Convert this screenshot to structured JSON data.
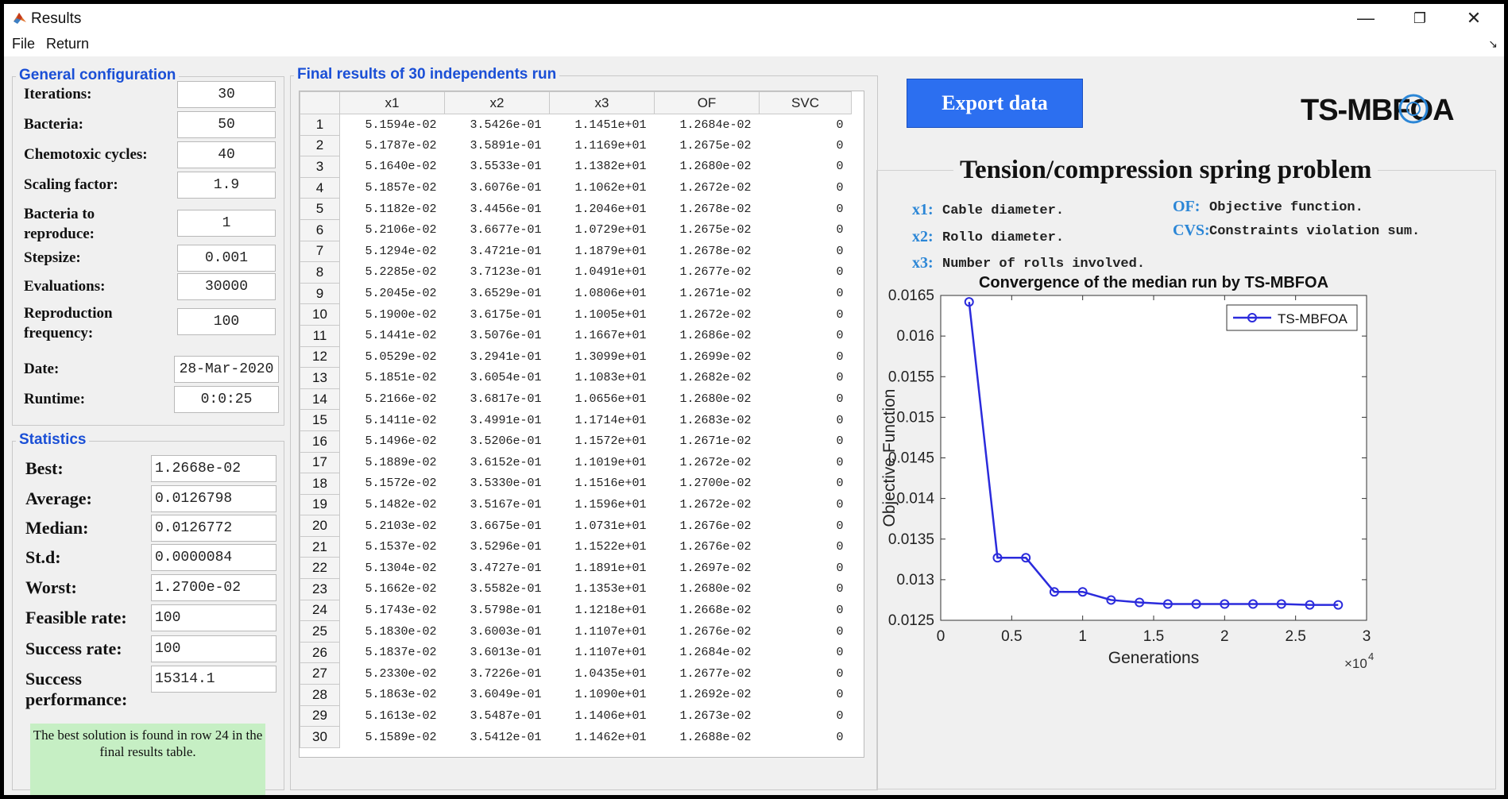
{
  "window": {
    "title": "Results",
    "minimize_glyph": "—",
    "maximize_glyph": "❐",
    "close_glyph": "✕"
  },
  "menu": {
    "file": "File",
    "return": "Return",
    "dock_glyph": "↘"
  },
  "general_config": {
    "title": "General configuration",
    "iterations_label": "Iterations:",
    "iterations": "30",
    "bacteria_label": "Bacteria:",
    "bacteria": "50",
    "chemotoxic_label": "Chemotoxic cycles:",
    "chemotoxic": "40",
    "scaling_label": "Scaling factor:",
    "scaling": "1.9",
    "reproduce_label_1": "Bacteria to",
    "reproduce_label_2": "reproduce:",
    "reproduce": "1",
    "stepsize_label": "Stepsize:",
    "stepsize": "0.001",
    "evaluations_label": "Evaluations:",
    "evaluations": "30000",
    "repro_freq_label_1": "Reproduction",
    "repro_freq_label_2": "frequency:",
    "repro_freq": "100",
    "date_label": "Date:",
    "date": "28-Mar-2020",
    "runtime_label": "Runtime:",
    "runtime": "0:0:25"
  },
  "statistics": {
    "title": "Statistics",
    "best_label": "Best:",
    "best": "1.2668e-02",
    "average_label": "Average:",
    "average": "0.0126798",
    "median_label": "Median:",
    "median": "0.0126772",
    "std_label": "St.d:",
    "std": "0.0000084",
    "worst_label": "Worst:",
    "worst": "1.2700e-02",
    "feasible_label": "Feasible rate:",
    "feasible": "100",
    "success_rate_label": "Success rate:",
    "success_rate": "100",
    "success_perf_label_1": "Success",
    "success_perf_label_2": "performance:",
    "success_perf": "15314.1",
    "note": "The best solution is found in row 24 in the final results table."
  },
  "results": {
    "title": "Final results of 30 independents run",
    "columns": [
      "x1",
      "x2",
      "x3",
      "OF",
      "SVC"
    ],
    "rows": [
      [
        "5.1594e-02",
        "3.5426e-01",
        "1.1451e+01",
        "1.2684e-02",
        "0"
      ],
      [
        "5.1787e-02",
        "3.5891e-01",
        "1.1169e+01",
        "1.2675e-02",
        "0"
      ],
      [
        "5.1640e-02",
        "3.5533e-01",
        "1.1382e+01",
        "1.2680e-02",
        "0"
      ],
      [
        "5.1857e-02",
        "3.6076e-01",
        "1.1062e+01",
        "1.2672e-02",
        "0"
      ],
      [
        "5.1182e-02",
        "3.4456e-01",
        "1.2046e+01",
        "1.2678e-02",
        "0"
      ],
      [
        "5.2106e-02",
        "3.6677e-01",
        "1.0729e+01",
        "1.2675e-02",
        "0"
      ],
      [
        "5.1294e-02",
        "3.4721e-01",
        "1.1879e+01",
        "1.2678e-02",
        "0"
      ],
      [
        "5.2285e-02",
        "3.7123e-01",
        "1.0491e+01",
        "1.2677e-02",
        "0"
      ],
      [
        "5.2045e-02",
        "3.6529e-01",
        "1.0806e+01",
        "1.2671e-02",
        "0"
      ],
      [
        "5.1900e-02",
        "3.6175e-01",
        "1.1005e+01",
        "1.2672e-02",
        "0"
      ],
      [
        "5.1441e-02",
        "3.5076e-01",
        "1.1667e+01",
        "1.2686e-02",
        "0"
      ],
      [
        "5.0529e-02",
        "3.2941e-01",
        "1.3099e+01",
        "1.2699e-02",
        "0"
      ],
      [
        "5.1851e-02",
        "3.6054e-01",
        "1.1083e+01",
        "1.2682e-02",
        "0"
      ],
      [
        "5.2166e-02",
        "3.6817e-01",
        "1.0656e+01",
        "1.2680e-02",
        "0"
      ],
      [
        "5.1411e-02",
        "3.4991e-01",
        "1.1714e+01",
        "1.2683e-02",
        "0"
      ],
      [
        "5.1496e-02",
        "3.5206e-01",
        "1.1572e+01",
        "1.2671e-02",
        "0"
      ],
      [
        "5.1889e-02",
        "3.6152e-01",
        "1.1019e+01",
        "1.2672e-02",
        "0"
      ],
      [
        "5.1572e-02",
        "3.5330e-01",
        "1.1516e+01",
        "1.2700e-02",
        "0"
      ],
      [
        "5.1482e-02",
        "3.5167e-01",
        "1.1596e+01",
        "1.2672e-02",
        "0"
      ],
      [
        "5.2103e-02",
        "3.6675e-01",
        "1.0731e+01",
        "1.2676e-02",
        "0"
      ],
      [
        "5.1537e-02",
        "3.5296e-01",
        "1.1522e+01",
        "1.2676e-02",
        "0"
      ],
      [
        "5.1304e-02",
        "3.4727e-01",
        "1.1891e+01",
        "1.2697e-02",
        "0"
      ],
      [
        "5.1662e-02",
        "3.5582e-01",
        "1.1353e+01",
        "1.2680e-02",
        "0"
      ],
      [
        "5.1743e-02",
        "3.5798e-01",
        "1.1218e+01",
        "1.2668e-02",
        "0"
      ],
      [
        "5.1830e-02",
        "3.6003e-01",
        "1.1107e+01",
        "1.2676e-02",
        "0"
      ],
      [
        "5.1837e-02",
        "3.6013e-01",
        "1.1107e+01",
        "1.2684e-02",
        "0"
      ],
      [
        "5.2330e-02",
        "3.7226e-01",
        "1.0435e+01",
        "1.2677e-02",
        "0"
      ],
      [
        "5.1863e-02",
        "3.6049e-01",
        "1.1090e+01",
        "1.2692e-02",
        "0"
      ],
      [
        "5.1613e-02",
        "3.5487e-01",
        "1.1406e+01",
        "1.2673e-02",
        "0"
      ],
      [
        "5.1589e-02",
        "3.5412e-01",
        "1.1462e+01",
        "1.2688e-02",
        "0"
      ]
    ]
  },
  "export_button": "Export data",
  "logo": {
    "text": "TS-MBFOA"
  },
  "problem": {
    "title": "Tension/compression spring problem",
    "legend": [
      {
        "key": "x1:",
        "desc": "Cable diameter."
      },
      {
        "key": "x2:",
        "desc": "Rollo diameter."
      },
      {
        "key": "x3:",
        "desc": "Number of rolls involved."
      },
      {
        "key": "OF:",
        "desc": "Objective function."
      },
      {
        "key": "CVS:",
        "desc": "Constraints violation sum."
      }
    ]
  },
  "colors": {
    "accent": "#1a4fd6",
    "button": "#2c6ff0",
    "series": "#2b2bdc",
    "note_bg": "#c6efc4",
    "legend_key": "#2b86d6"
  },
  "chart_data": {
    "type": "line",
    "title": "Convergence of the median run by TS-MBFOA",
    "xlabel": "Generations",
    "ylabel": "Objective Function",
    "x_exponent_label": "×10",
    "x_exponent_power": "4",
    "xlim": [
      0,
      30000
    ],
    "ylim": [
      0.0125,
      0.0165
    ],
    "xticks": [
      0,
      5000,
      10000,
      15000,
      20000,
      25000,
      30000
    ],
    "xtick_labels": [
      "0",
      "0.5",
      "1",
      "1.5",
      "2",
      "2.5",
      "3"
    ],
    "yticks": [
      0.0125,
      0.013,
      0.0135,
      0.014,
      0.0145,
      0.015,
      0.0155,
      0.016,
      0.0165
    ],
    "ytick_labels": [
      "0.0125",
      "0.013",
      "0.0135",
      "0.014",
      "0.0145",
      "0.015",
      "0.0155",
      "0.016",
      "0.0165"
    ],
    "grid": false,
    "legend_position": "top-right",
    "series": [
      {
        "name": "TS-MBFOA",
        "x": [
          2000,
          4000,
          6000,
          8000,
          10000,
          12000,
          14000,
          16000,
          18000,
          20000,
          22000,
          24000,
          26000,
          28000
        ],
        "y": [
          0.01642,
          0.01327,
          0.01327,
          0.01285,
          0.01285,
          0.01275,
          0.01272,
          0.0127,
          0.0127,
          0.0127,
          0.0127,
          0.0127,
          0.01269,
          0.01269
        ]
      }
    ]
  }
}
